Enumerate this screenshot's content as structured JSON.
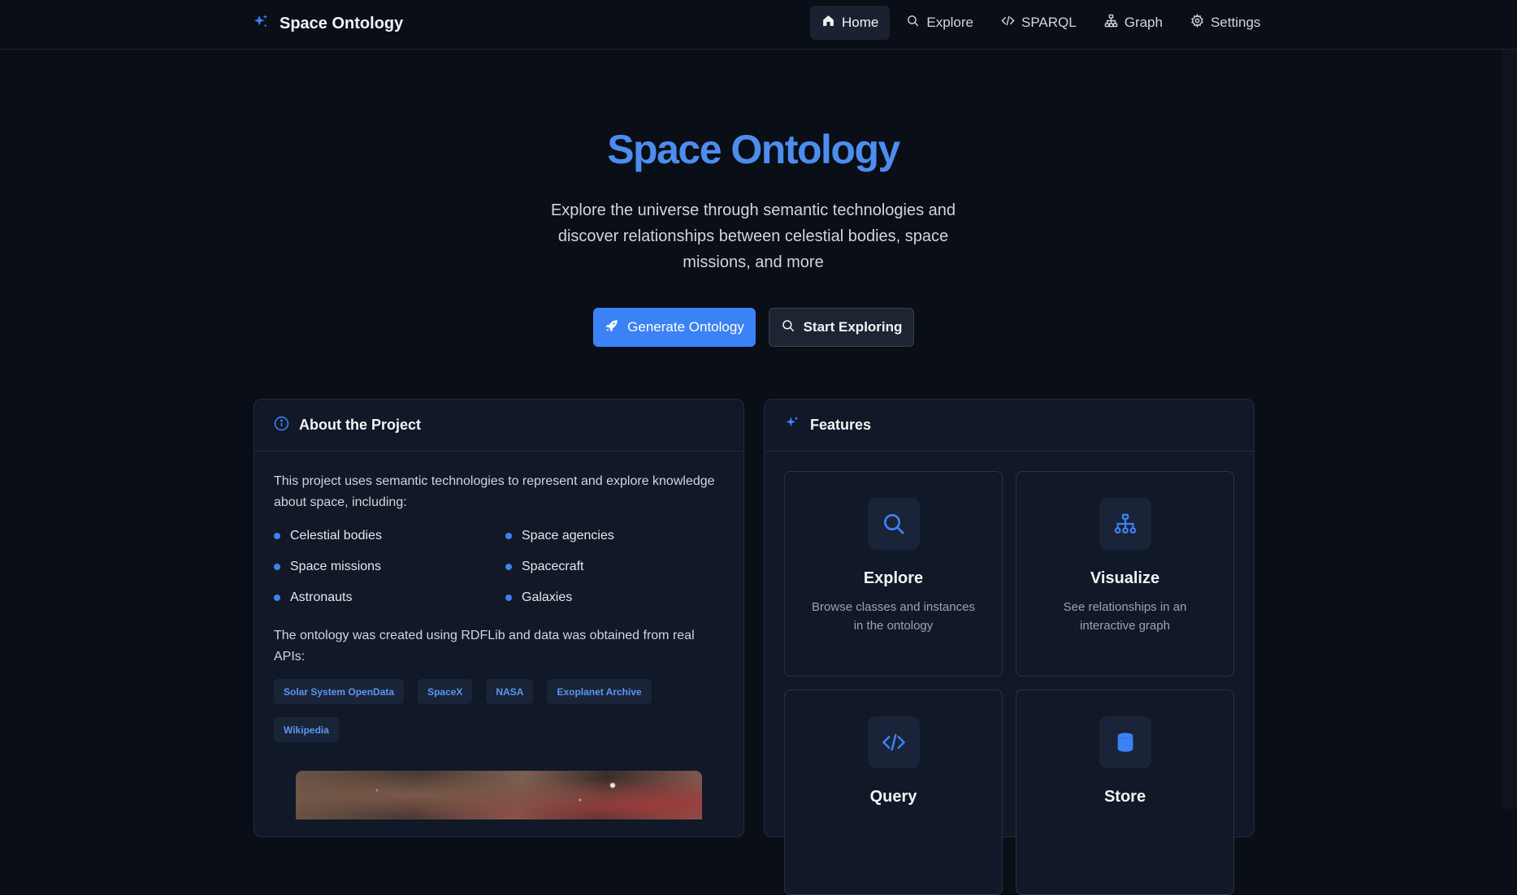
{
  "nav": {
    "brand": "Space Ontology",
    "links": [
      {
        "label": "Home",
        "icon": "home-icon",
        "active": true
      },
      {
        "label": "Explore",
        "icon": "search-icon"
      },
      {
        "label": "SPARQL",
        "icon": "code-icon"
      },
      {
        "label": "Graph",
        "icon": "network-icon"
      },
      {
        "label": "Settings",
        "icon": "gear-icon"
      }
    ]
  },
  "hero": {
    "title": "Space Ontology",
    "subtitle": "Explore the universe through semantic technologies and discover relationships between celestial bodies, space missions, and more",
    "primary_button": "Generate Ontology",
    "secondary_button": "Start Exploring"
  },
  "about": {
    "title": "About the Project",
    "intro": "This project uses semantic technologies to represent and explore knowledge about space, including:",
    "items": [
      "Celestial bodies",
      "Space agencies",
      "Space missions",
      "Spacecraft",
      "Astronauts",
      "Galaxies"
    ],
    "sources_text": "The ontology was created using RDFLib and data was obtained from real APIs:",
    "tags": [
      "Solar System OpenData",
      "SpaceX",
      "NASA",
      "Exoplanet Archive",
      "Wikipedia"
    ]
  },
  "features": {
    "title": "Features",
    "items": [
      {
        "title": "Explore",
        "description": "Browse classes and instances in the ontology",
        "icon": "search-icon"
      },
      {
        "title": "Visualize",
        "description": "See relationships in an interactive graph",
        "icon": "network-icon"
      },
      {
        "title": "Query",
        "description": "",
        "icon": "code-icon"
      },
      {
        "title": "Store",
        "description": "",
        "icon": "database-icon"
      }
    ]
  },
  "colors": {
    "background": "#0a0e17",
    "accent": "#3b82f6",
    "title_blue": "#4c8dee",
    "card": "#111827"
  }
}
